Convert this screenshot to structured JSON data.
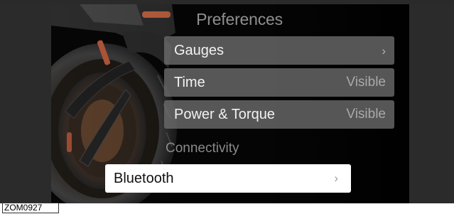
{
  "header": {
    "title": "Preferences"
  },
  "menu": {
    "items": [
      {
        "label": "Gauges",
        "value": "",
        "chevron": "›"
      },
      {
        "label": "Time",
        "value": "Visible",
        "chevron": ""
      },
      {
        "label": "Power & Torque",
        "value": "Visible",
        "chevron": ""
      }
    ]
  },
  "connectivity": {
    "section_label": "Connectivity",
    "bluetooth": {
      "label": "Bluetooth",
      "chevron": "›"
    }
  },
  "image_id": "ZOM0927",
  "colors": {
    "screen_bg": "#050505",
    "row_bg": "#6e6e6e",
    "selected_row_bg": "#ffffff",
    "accent_orange": "#c0613f"
  },
  "icons": {
    "gauges_chevron": "chevron-right-icon",
    "bluetooth_chevron": "chevron-right-icon"
  }
}
